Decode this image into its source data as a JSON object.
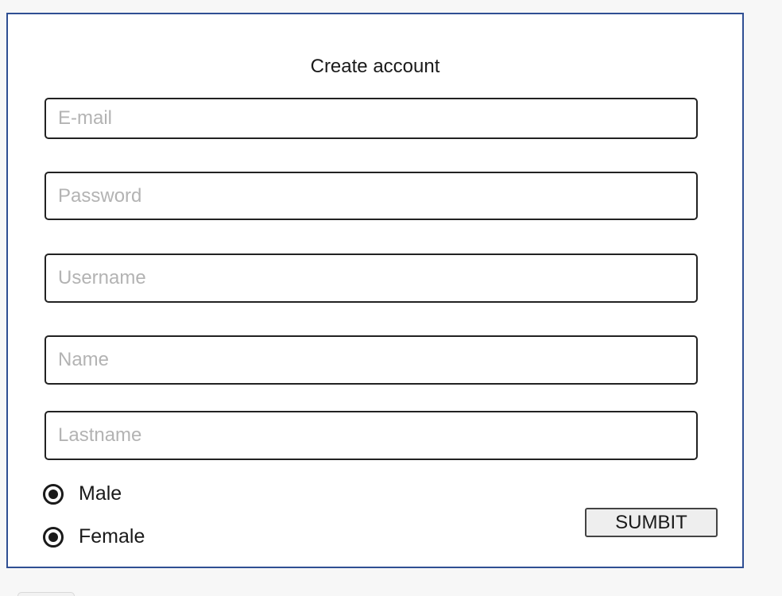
{
  "form": {
    "title": "Create account",
    "fields": {
      "email": {
        "placeholder": "E-mail",
        "value": ""
      },
      "password": {
        "placeholder": "Password",
        "value": ""
      },
      "username": {
        "placeholder": "Username",
        "value": ""
      },
      "name": {
        "placeholder": "Name",
        "value": ""
      },
      "lastname": {
        "placeholder": "Lastname",
        "value": ""
      }
    },
    "gender": {
      "options": [
        {
          "label": "Male",
          "selected": true
        },
        {
          "label": "Female",
          "selected": true
        }
      ]
    },
    "submit_label": "SUMBIT"
  },
  "colors": {
    "card_border": "#2f4f93",
    "placeholder_text": "#b3b3b3",
    "button_bg": "#eeeeee",
    "page_bg": "#f7f7f7"
  },
  "icons": [
    "radio-selected-icon"
  ]
}
